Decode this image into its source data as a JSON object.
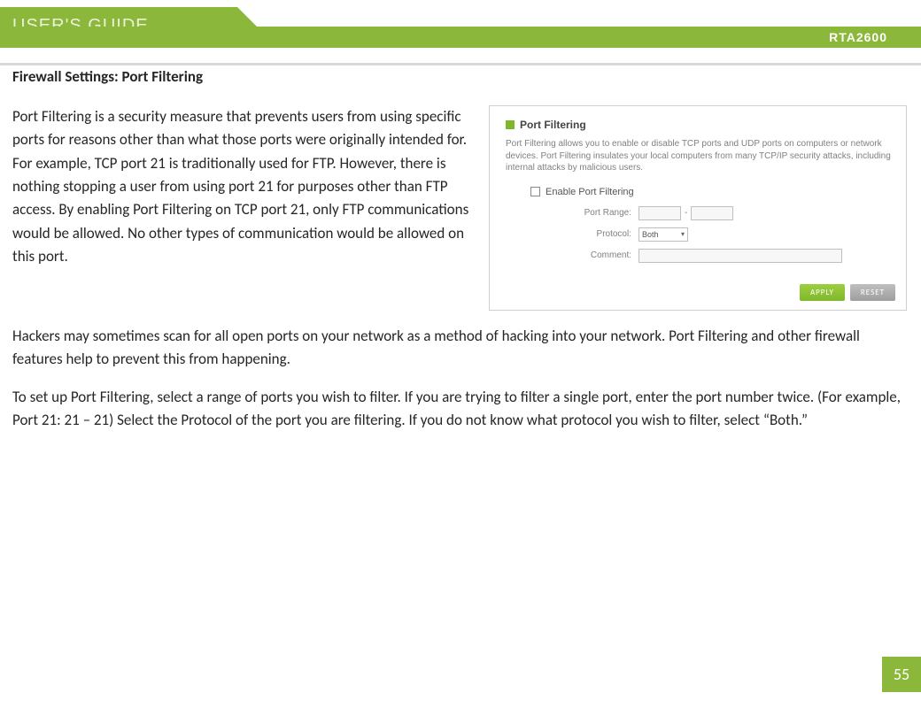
{
  "header": {
    "guide_label": "USER'S GUIDE",
    "model": "RTA2600"
  },
  "section_title": "Firewall Settings: Port Filtering",
  "paragraphs": {
    "intro": "Port Filtering is a security measure that prevents users from using specific ports for reasons other than what those ports were originally intended for.  For example, TCP port 21 is traditionally used for FTP.  However, there is nothing stopping a user from using port 21 for purposes other than FTP access.  By enabling Port Filtering on TCP port 21, only FTP communications would be allowed.  No other types of communication would be allowed on this port.",
    "hackers": "Hackers may sometimes scan for all open ports on your network as a method of hacking into your network.  Port Filtering and other firewall features help to prevent this from happening.",
    "setup": "To set up Port Filtering, select a range of ports you wish to filter.  If you are trying to filter a single port, enter the port number twice.  (For example, Port 21:  21 – 21) Select the Protocol of the port you are filtering.  If you do not know what protocol you wish to filter, select “Both.”"
  },
  "screenshot": {
    "title": "Port Filtering",
    "description": "Port Filtering allows you to enable or disable TCP ports and UDP ports on computers or network devices. Port Filtering insulates your local computers from many TCP/IP security attacks, including internal attacks by malicious users.",
    "enable_label": "Enable Port Filtering",
    "fields": {
      "port_range": "Port Range:",
      "protocol": "Protocol:",
      "protocol_value": "Both",
      "comment": "Comment:"
    },
    "buttons": {
      "apply": "APPLY",
      "reset": "RESET"
    }
  },
  "page_number": "55"
}
